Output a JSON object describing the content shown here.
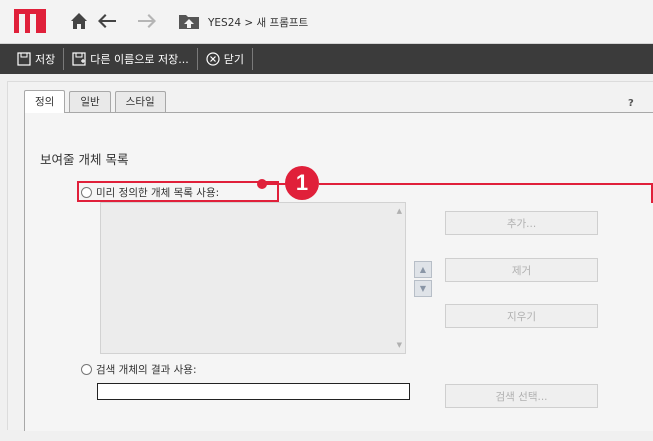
{
  "nav": {
    "breadcrumb": "YES24 > 새 프롬프트",
    "icons": [
      "home-icon",
      "back-arrow-icon",
      "forward-arrow-icon",
      "folder-up-icon"
    ],
    "brand_color": "#e0203a"
  },
  "toolbar": {
    "save_label": "저장",
    "save_as_label": "다른 이름으로 저장...",
    "close_label": "닫기"
  },
  "dialog": {
    "tabs": [
      "정의",
      "일반",
      "스타일"
    ],
    "active_tab": "정의",
    "help": "?",
    "section_title": "보여줄 개체 목록",
    "option_predefined": "미리 정의한 개체 목록 사용:",
    "option_search": "검색 개체의 결과 사용:",
    "buttons": {
      "add": "추가...",
      "remove": "제거",
      "clear": "지우기",
      "select_search": "검색 선택..."
    },
    "search_input_value": ""
  },
  "callout": {
    "number": "1",
    "color": "#e0203a"
  }
}
